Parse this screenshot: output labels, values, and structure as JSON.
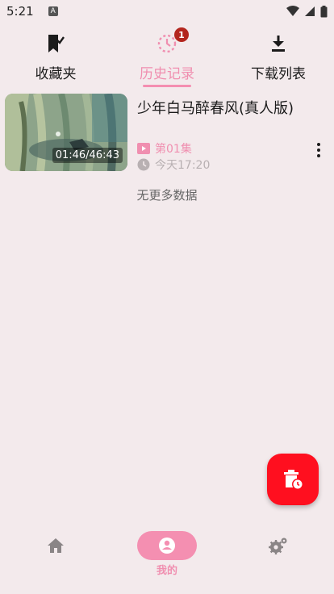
{
  "status_bar": {
    "time": "5:21",
    "notification_letter": "A"
  },
  "tabs": [
    {
      "label": "收藏夹",
      "icon": "bookmark-check-icon",
      "active": false
    },
    {
      "label": "历史记录",
      "icon": "history-icon",
      "active": true,
      "badge": "1"
    },
    {
      "label": "下载列表",
      "icon": "download-icon",
      "active": false
    }
  ],
  "history": {
    "items": [
      {
        "title": "少年白马醉春风(真人版)",
        "progress": "01:46/46:43",
        "episode": "第01集",
        "watched_at": "今天17:20"
      }
    ],
    "end_text": "无更多数据"
  },
  "fab": {
    "icon": "delete-history-icon"
  },
  "bottom_nav": [
    {
      "label": "",
      "icon": "home-icon",
      "active": false
    },
    {
      "label": "我的",
      "icon": "profile-icon",
      "active": true
    },
    {
      "label": "",
      "icon": "settings-icon",
      "active": false
    }
  ],
  "colors": {
    "accent": "#f48fb1",
    "fab": "#ff0f1f",
    "background": "#f3eaec",
    "badge": "#b3261e"
  }
}
